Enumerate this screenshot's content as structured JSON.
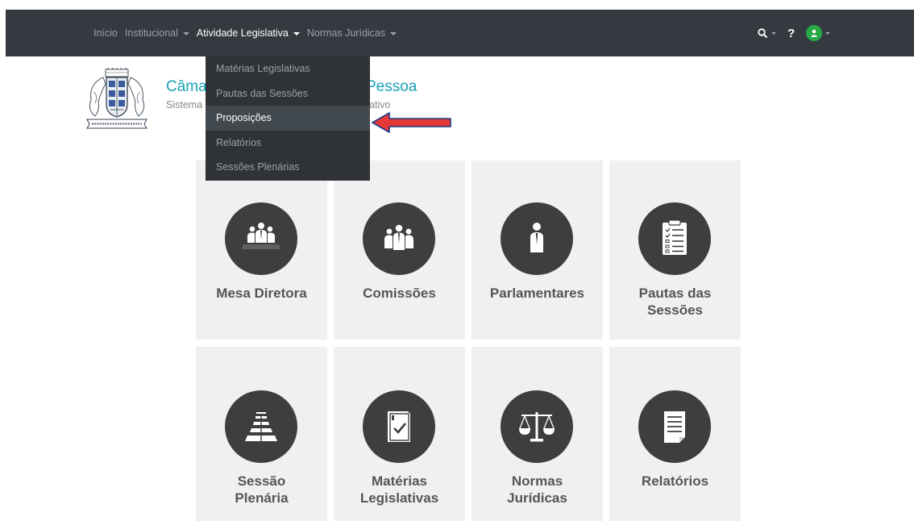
{
  "navbar": {
    "items": [
      {
        "label": "Início",
        "dropdown": false,
        "active": false
      },
      {
        "label": "Institucional",
        "dropdown": true,
        "active": false
      },
      {
        "label": "Atividade Legislativa",
        "dropdown": true,
        "active": true
      },
      {
        "label": "Normas Jurídicas",
        "dropdown": true,
        "active": false
      }
    ],
    "help_label": "?",
    "colors": {
      "background": "#343a40",
      "avatar": "#28a745"
    }
  },
  "header": {
    "title_left": "Câma",
    "title_right": "Pessoa",
    "subtitle_left": "Sistema",
    "subtitle_right": "ativo",
    "title_color": "#17a2b8"
  },
  "dropdown": {
    "items": [
      {
        "label": "Matérias Legislativas",
        "active": false
      },
      {
        "label": "Pautas das Sessões",
        "active": false
      },
      {
        "label": "Proposições",
        "active": true
      },
      {
        "label": "Relatórios",
        "active": false
      },
      {
        "label": "Sessões Plenárias",
        "active": false
      }
    ]
  },
  "annotation": {
    "arrow_color": "#e53935",
    "arrow_outline": "#1e3a8a",
    "points_to": "Proposições"
  },
  "tiles": [
    {
      "label_lines": [
        "Mesa Diretora"
      ],
      "icon": "mesa-diretora-icon"
    },
    {
      "label_lines": [
        "Comissões"
      ],
      "icon": "comissoes-icon"
    },
    {
      "label_lines": [
        "Parlamentares"
      ],
      "icon": "parlamentares-icon"
    },
    {
      "label_lines": [
        "Pautas das",
        "Sessões"
      ],
      "icon": "pautas-clipboard-icon"
    },
    {
      "label_lines": [
        "Sessão",
        "Plenária"
      ],
      "icon": "sessao-plenaria-icon"
    },
    {
      "label_lines": [
        "Matérias",
        "Legislativas"
      ],
      "icon": "materias-book-icon"
    },
    {
      "label_lines": [
        "Normas",
        "Jurídicas"
      ],
      "icon": "scales-icon"
    },
    {
      "label_lines": [
        "Relatórios"
      ],
      "icon": "relatorio-document-icon"
    }
  ]
}
